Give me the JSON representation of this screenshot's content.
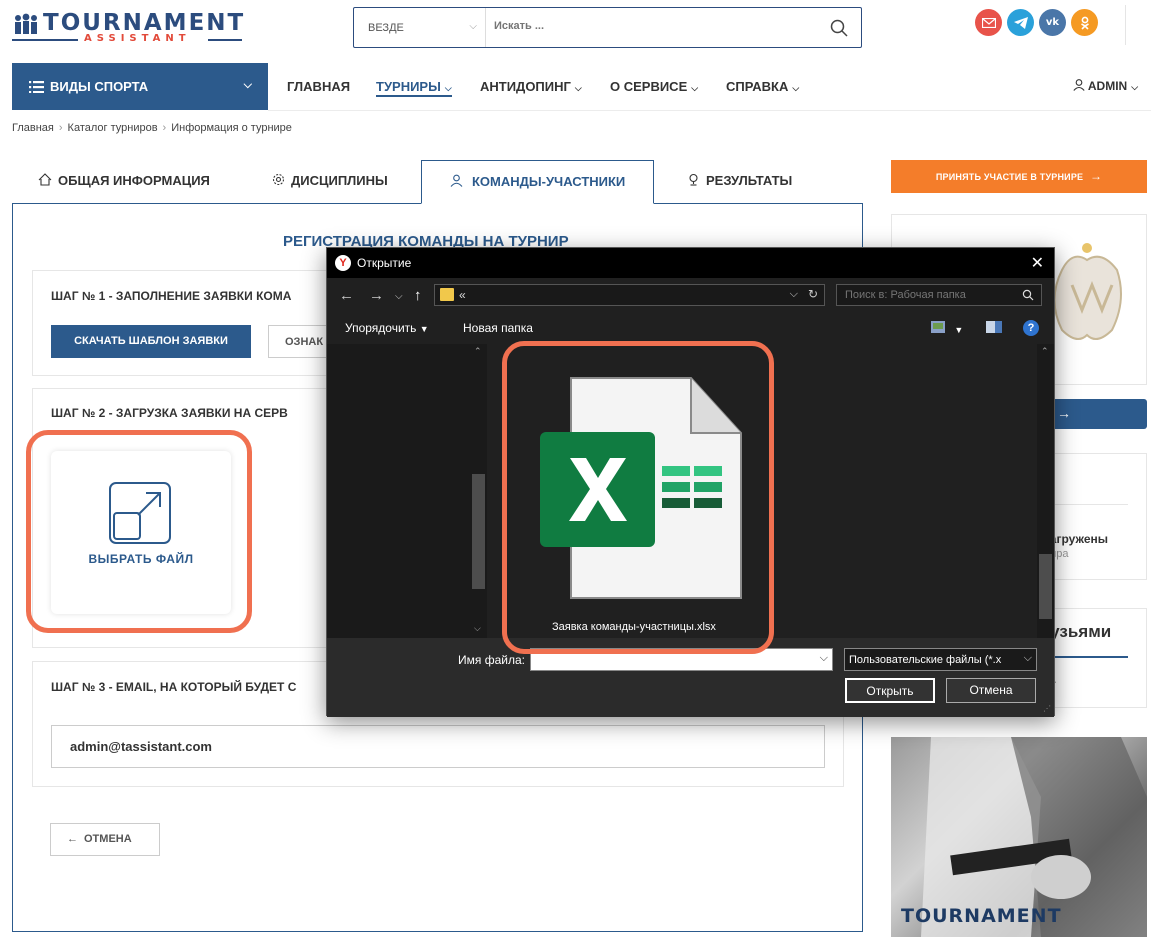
{
  "header": {
    "logo_main": "TOURNAMENT",
    "logo_sub": "ASSISTANT",
    "search_scope": "ВЕЗДЕ",
    "search_placeholder": "Искать ...",
    "social": [
      {
        "name": "mail",
        "color": "#e8534a"
      },
      {
        "name": "telegram",
        "color": "#2aa1da"
      },
      {
        "name": "vk",
        "color": "#4a76a8"
      },
      {
        "name": "odnoklassniki",
        "color": "#f59a23"
      }
    ]
  },
  "nav": {
    "sports": "ВИДЫ СПОРТА",
    "items": [
      "ГЛАВНАЯ",
      "ТУРНИРЫ",
      "АНТИДОПИНГ",
      "О СЕРВИСЕ",
      "СПРАВКА"
    ],
    "admin": "ADMIN"
  },
  "breadcrumb": [
    "Главная",
    "Каталог турниров",
    "Информация о турнире"
  ],
  "tabs": [
    "ОБЩАЯ ИНФОРМАЦИЯ",
    "ДИСЦИПЛИНЫ",
    "КОМАНДЫ-УЧАСТНИКИ",
    "РЕЗУЛЬТАТЫ"
  ],
  "main": {
    "title": "РЕГИСТРАЦИЯ КОМАНДЫ НА ТУРНИР",
    "step1_title": "ШАГ № 1 - ЗАПОЛНЕНИЕ ЗАЯВКИ КОМА",
    "download_btn": "СКАЧАТЬ ШАБЛОН ЗАЯВКИ",
    "view_btn": "ОЗНАК",
    "step2_title": "ШАГ № 2 - ЗАГРУЗКА ЗАЯВКИ НА СЕРВ",
    "choose_file": "ВЫБРАТЬ ФАЙЛ",
    "step3_title": "ШАГ № 3 - EMAIL, НА КОТОРЫЙ БУДЕТ С",
    "email_value": "admin@tassistant.com",
    "cancel_btn": "ОТМЕНА"
  },
  "sidebar": {
    "join_btn": "ПРИНЯТЬ УЧАСТИЕ В ТУРНИРЕ",
    "arrow": "→",
    "loaded_text": "загружены",
    "loaded_sub": "нира",
    "friends_text": "рузьями",
    "dots": "...",
    "photo_text": "TOURNAMENT"
  },
  "dialog": {
    "title": "Открытие",
    "address": "«",
    "search_placeholder": "Поиск в: Рабочая папка",
    "organize": "Упорядочить",
    "new_folder": "Новая папка",
    "file_name": "Заявка команды-участницы.xlsx",
    "filename_label": "Имя файла:",
    "filename_value": "",
    "filter": "Пользовательские файлы (*.x",
    "open_btn": "Открыть",
    "cancel_btn": "Отмена"
  },
  "colors": {
    "brand_blue": "#2c5a8c",
    "accent_orange": "#f47d2a",
    "highlight": "#f07050",
    "excel_green": "#107c41"
  }
}
